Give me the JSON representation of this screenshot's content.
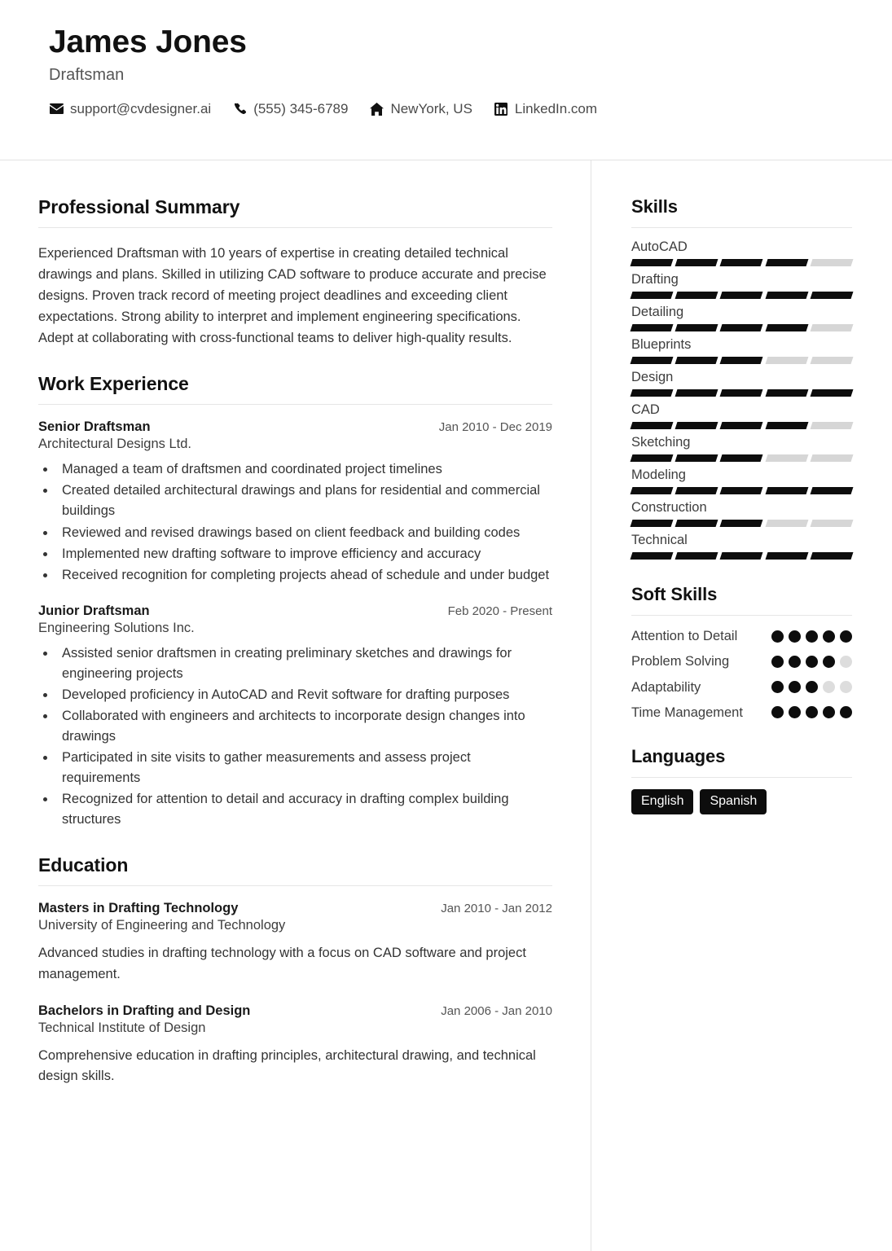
{
  "header": {
    "full_name": "James Jones",
    "job_title": "Draftsman",
    "contacts": [
      {
        "icon": "email-icon",
        "value": "support@cvdesigner.ai"
      },
      {
        "icon": "phone-icon",
        "value": "(555) 345-6789"
      },
      {
        "icon": "home-icon",
        "value": "NewYork, US"
      },
      {
        "icon": "linkedin-icon",
        "value": "LinkedIn.com"
      }
    ]
  },
  "main": {
    "summary": {
      "heading": "Professional Summary",
      "text": "Experienced Draftsman with 10 years of expertise in creating detailed technical drawings and plans. Skilled in utilizing CAD software to produce accurate and precise designs. Proven track record of meeting project deadlines and exceeding client expectations. Strong ability to interpret and implement engineering specifications. Adept at collaborating with cross-functional teams to deliver high-quality results."
    },
    "experience": {
      "heading": "Work Experience",
      "entries": [
        {
          "role": "Senior Draftsman",
          "date": "Jan 2010 - Dec 2019",
          "org": "Architectural Designs Ltd.",
          "bullets": [
            "Managed a team of draftsmen and coordinated project timelines",
            "Created detailed architectural drawings and plans for residential and commercial buildings",
            "Reviewed and revised drawings based on client feedback and building codes",
            "Implemented new drafting software to improve efficiency and accuracy",
            "Received recognition for completing projects ahead of schedule and under budget"
          ]
        },
        {
          "role": "Junior Draftsman",
          "date": "Feb 2020 - Present",
          "org": "Engineering Solutions Inc.",
          "bullets": [
            "Assisted senior draftsmen in creating preliminary sketches and drawings for engineering projects",
            "Developed proficiency in AutoCAD and Revit software for drafting purposes",
            "Collaborated with engineers and architects to incorporate design changes into drawings",
            "Participated in site visits to gather measurements and assess project requirements",
            "Recognized for attention to detail and accuracy in drafting complex building structures"
          ]
        }
      ]
    },
    "education": {
      "heading": "Education",
      "entries": [
        {
          "degree": "Masters in Drafting Technology",
          "date": "Jan 2010 - Jan 2012",
          "school": "University of Engineering and Technology",
          "description": "Advanced studies in drafting technology with a focus on CAD software and project management."
        },
        {
          "degree": "Bachelors in Drafting and Design",
          "date": "Jan 2006 - Jan 2010",
          "school": "Technical Institute of Design",
          "description": "Comprehensive education in drafting principles, architectural drawing, and technical design skills."
        }
      ]
    }
  },
  "sidebar": {
    "skills": {
      "heading": "Skills",
      "max": 5,
      "items": [
        {
          "name": "AutoCAD",
          "level": 4
        },
        {
          "name": "Drafting",
          "level": 5
        },
        {
          "name": "Detailing",
          "level": 4
        },
        {
          "name": "Blueprints",
          "level": 3
        },
        {
          "name": "Design",
          "level": 5
        },
        {
          "name": "CAD",
          "level": 4
        },
        {
          "name": "Sketching",
          "level": 3
        },
        {
          "name": "Modeling",
          "level": 5
        },
        {
          "name": "Construction",
          "level": 3
        },
        {
          "name": "Technical",
          "level": 5
        }
      ]
    },
    "soft_skills": {
      "heading": "Soft Skills",
      "max": 5,
      "items": [
        {
          "name": "Attention to Detail",
          "level": 5
        },
        {
          "name": "Problem Solving",
          "level": 4
        },
        {
          "name": "Adaptability",
          "level": 3
        },
        {
          "name": "Time Management",
          "level": 5
        }
      ]
    },
    "languages": {
      "heading": "Languages",
      "items": [
        "English",
        "Spanish"
      ]
    }
  },
  "colors": {
    "accent": "#0d0d0d",
    "bar_empty": "#d6d6d6",
    "divider": "#e2e2e2",
    "text": "#333333"
  }
}
